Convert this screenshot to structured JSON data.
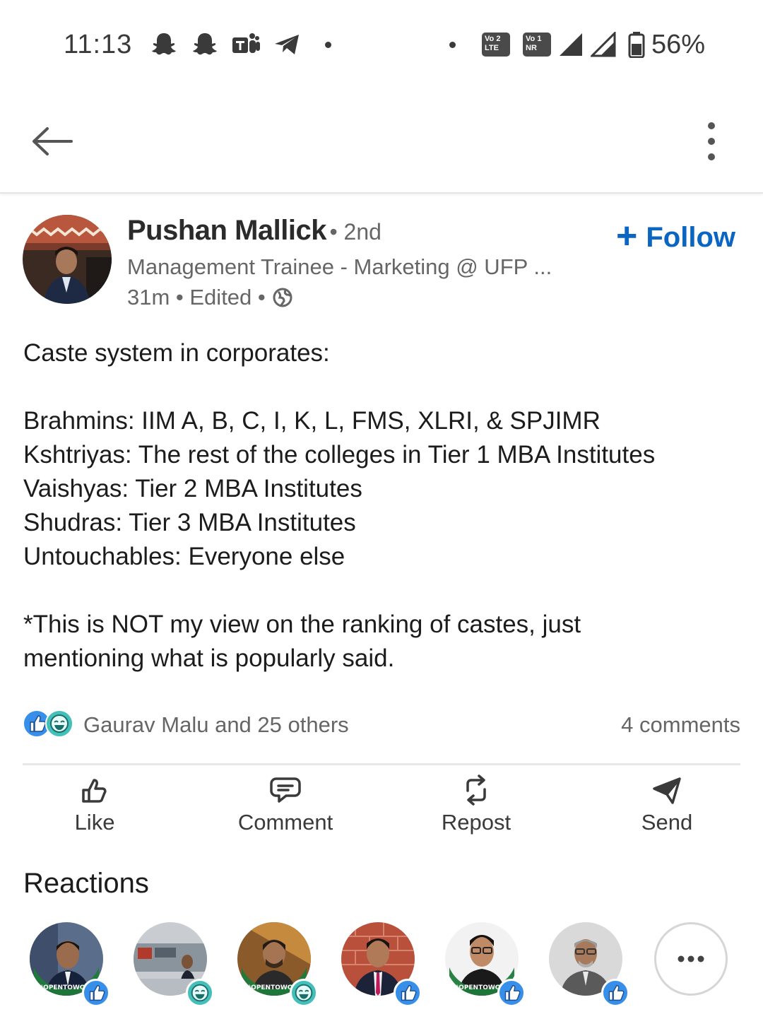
{
  "status_bar": {
    "time": "11:13",
    "volte1": [
      "Vo",
      "LTE",
      "2"
    ],
    "volte2": [
      "Vo",
      "NR",
      "1"
    ],
    "battery": "56%",
    "icons": [
      "snapchat-icon",
      "snapchat-icon",
      "teams-icon",
      "telegram-icon",
      "signal-icon",
      "signal-icon",
      "battery-icon"
    ]
  },
  "app_bar": {
    "back_icon": "arrow-left-icon",
    "more_icon": "vertical-dots-icon"
  },
  "post": {
    "author": "Pushan Mallick",
    "degree": "• 2nd",
    "headline": "Management Trainee - Marketing @ UFP ...",
    "meta": "31m • Edited •",
    "follow_label": "Follow",
    "follow_plus": "+",
    "body": {
      "line1": "Caste system in corporates:",
      "line2": "Brahmins: IIM A, B, C, I, K, L, FMS, XLRI, & SPJIMR",
      "line3": "Kshtriyas: The rest of the colleges in Tier 1 MBA Institutes",
      "line4": "Vaishyas: Tier 2 MBA Institutes",
      "line5": "Shudras: Tier 3 MBA Institutes",
      "line6": "Untouchables: Everyone else",
      "line7": "*This is NOT my view on the ranking of castes, just",
      "line8": "mentioning what is popularly said."
    },
    "likers": "Gaurav Malu and 25 others",
    "comments": "4 comments"
  },
  "actions": {
    "like": "Like",
    "comment": "Comment",
    "repost": "Repost",
    "send": "Send"
  },
  "reactions": {
    "title": "Reactions",
    "badges": [
      "like",
      "funny",
      "funny",
      "like",
      "like",
      "like"
    ],
    "open_to_work": [
      true,
      false,
      true,
      false,
      true,
      false
    ]
  },
  "colors": {
    "accent": "#0a66c2",
    "like_badge": "#378fe9",
    "funny_badge": "#44bfba",
    "open_to_work": "#1f7a3a"
  }
}
